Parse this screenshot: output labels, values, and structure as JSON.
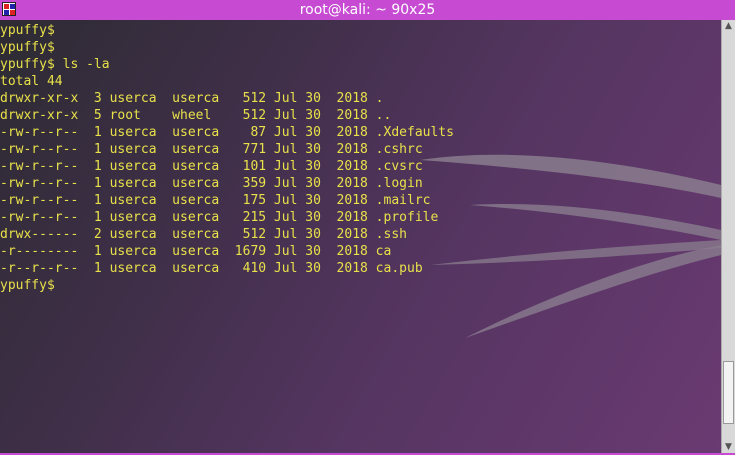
{
  "window": {
    "title": "root@kali: ~ 90x25"
  },
  "colors": {
    "titlebar": "#c64bd2",
    "text": "#e8e14a",
    "background": "#4a3152"
  },
  "terminal": {
    "lines": [
      "ypuffy$",
      "ypuffy$",
      "ypuffy$ ls -la",
      "total 44",
      "drwxr-xr-x  3 userca  userca   512 Jul 30  2018 .",
      "drwxr-xr-x  5 root    wheel    512 Jul 30  2018 ..",
      "-rw-r--r--  1 userca  userca    87 Jul 30  2018 .Xdefaults",
      "-rw-r--r--  1 userca  userca   771 Jul 30  2018 .cshrc",
      "-rw-r--r--  1 userca  userca   101 Jul 30  2018 .cvsrc",
      "-rw-r--r--  1 userca  userca   359 Jul 30  2018 .login",
      "-rw-r--r--  1 userca  userca   175 Jul 30  2018 .mailrc",
      "-rw-r--r--  1 userca  userca   215 Jul 30  2018 .profile",
      "drwx------  2 userca  userca   512 Jul 30  2018 .ssh",
      "-r--------  1 userca  userca  1679 Jul 30  2018 ca",
      "-r--r--r--  1 userca  userca   410 Jul 30  2018 ca.pub",
      "ypuffy$"
    ]
  },
  "scrollbar": {
    "up_icon": "scroll-up-arrow-icon",
    "down_icon": "scroll-down-arrow-icon",
    "position_fraction": 0.95
  }
}
